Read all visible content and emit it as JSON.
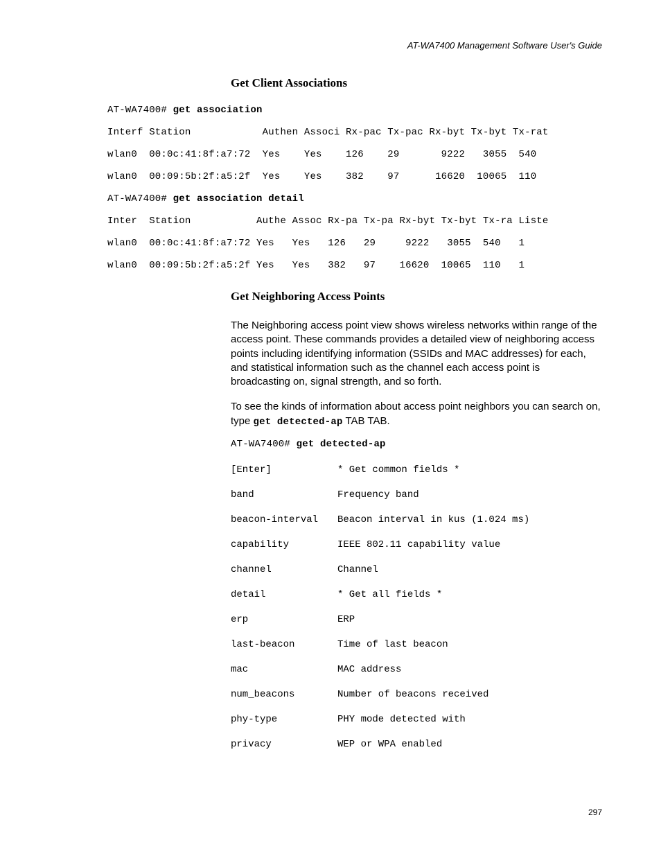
{
  "header": {
    "guide_title": "AT-WA7400 Management Software User's Guide"
  },
  "section1": {
    "heading": "Get Client Associations",
    "prompt1_prefix": "AT-WA7400# ",
    "prompt1_cmd": "get association",
    "table1_header": "Interf Station            Authen Associ Rx-pac Tx-pac Rx-byt Tx-byt Tx-rat",
    "table1_rows": [
      "wlan0  00:0c:41:8f:a7:72  Yes    Yes    126    29       9222   3055  540",
      "wlan0  00:09:5b:2f:a5:2f  Yes    Yes    382    97      16620  10065  110"
    ],
    "prompt2_prefix": "AT-WA7400# ",
    "prompt2_cmd": "get association detail",
    "table2_header": "Inter  Station           Authe Assoc Rx-pa Tx-pa Rx-byt Tx-byt Tx-ra Liste",
    "table2_rows": [
      "wlan0  00:0c:41:8f:a7:72 Yes   Yes   126   29     9222   3055  540   1",
      "wlan0  00:09:5b:2f:a5:2f Yes   Yes   382   97    16620  10065  110   1"
    ]
  },
  "section2": {
    "heading": "Get Neighboring Access Points",
    "para1": "The Neighboring access point view shows wireless networks within range of the access point. These commands provides a detailed view of neighboring access points including identifying information (SSIDs and MAC addresses) for each, and statistical information such as the channel each access point is broadcasting on, signal strength, and so forth.",
    "para2_pre": "To see the kinds of information about access point neighbors you can search on, type ",
    "para2_cmd": "get detected-ap",
    "para2_post": " TAB TAB.",
    "prompt_prefix": "AT-WA7400# ",
    "prompt_cmd": "get detected-ap",
    "fields": [
      {
        "key": "[Enter]",
        "desc": "* Get common fields *"
      },
      {
        "key": "band",
        "desc": "Frequency band"
      },
      {
        "key": "beacon-interval",
        "desc": "Beacon interval in kus (1.024 ms)"
      },
      {
        "key": "capability",
        "desc": "IEEE 802.11 capability value"
      },
      {
        "key": "channel",
        "desc": "Channel"
      },
      {
        "key": "detail",
        "desc": "* Get all fields *"
      },
      {
        "key": "erp",
        "desc": "ERP"
      },
      {
        "key": "last-beacon",
        "desc": "Time of last beacon"
      },
      {
        "key": "mac",
        "desc": "MAC address"
      },
      {
        "key": "num_beacons",
        "desc": "Number of beacons received"
      },
      {
        "key": "phy-type",
        "desc": "PHY mode detected with"
      },
      {
        "key": "privacy",
        "desc": "WEP or WPA enabled"
      }
    ]
  },
  "footer": {
    "page_number": "297"
  }
}
